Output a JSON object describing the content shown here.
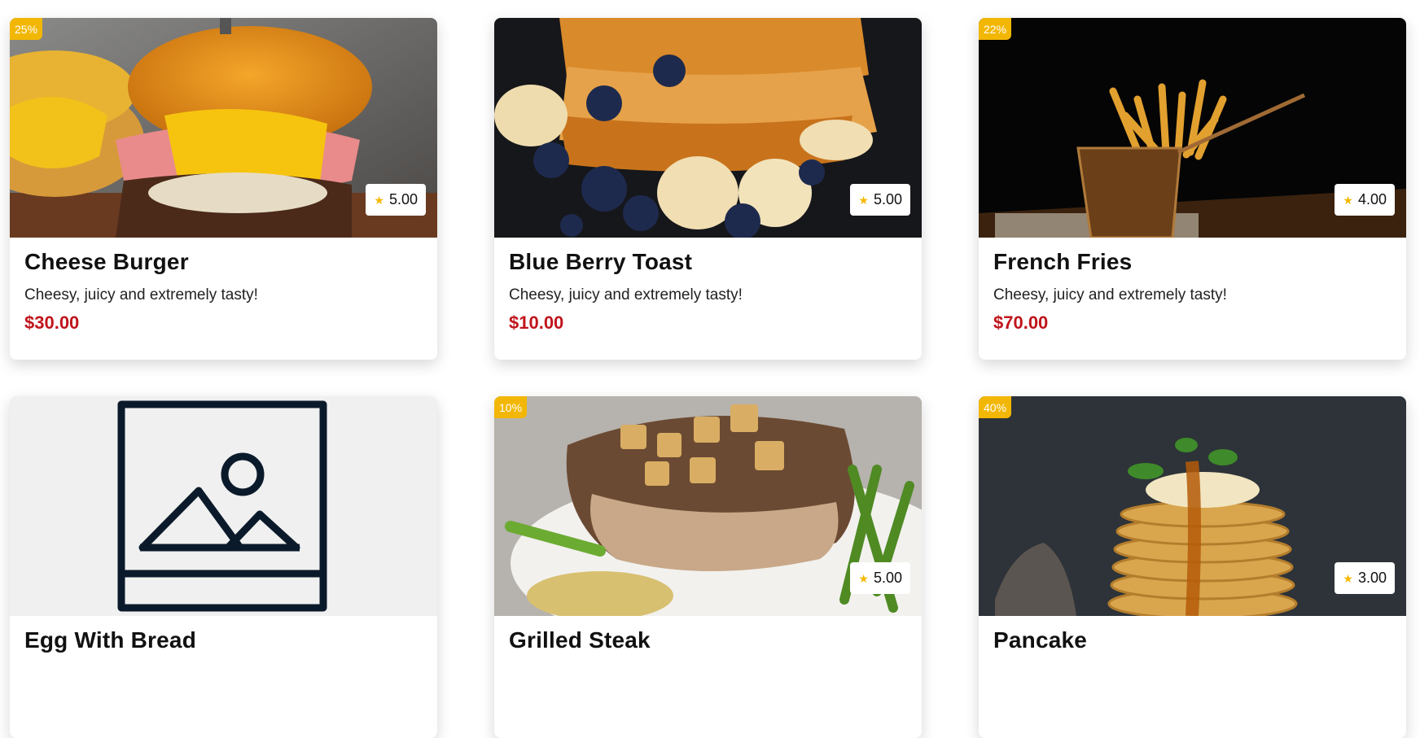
{
  "colors": {
    "discount_badge": "#f2b705",
    "price": "#c0141b",
    "star": "#f5b800",
    "placeholder_icon": "#0b1a2b"
  },
  "cards": [
    {
      "title": "Cheese Burger",
      "description": "Cheesy, juicy and extremely tasty!",
      "price": "$30.00",
      "rating": "5.00",
      "discount": "25%",
      "image": "cheese-burger-photo"
    },
    {
      "title": "Blue Berry Toast",
      "description": "Cheesy, juicy and extremely tasty!",
      "price": "$10.00",
      "rating": "5.00",
      "discount": "",
      "image": "blueberry-toast-photo"
    },
    {
      "title": "French Fries",
      "description": "Cheesy, juicy and extremely tasty!",
      "price": "$70.00",
      "rating": "4.00",
      "discount": "22%",
      "image": "french-fries-photo"
    },
    {
      "title": "Egg With Bread",
      "description": "",
      "price": "",
      "rating": "",
      "discount": "",
      "image": "image-placeholder-icon"
    },
    {
      "title": "Grilled Steak",
      "description": "",
      "price": "",
      "rating": "5.00",
      "discount": "10%",
      "image": "grilled-steak-photo"
    },
    {
      "title": "Pancake",
      "description": "",
      "price": "",
      "rating": "3.00",
      "discount": "40%",
      "image": "pancake-photo"
    }
  ]
}
